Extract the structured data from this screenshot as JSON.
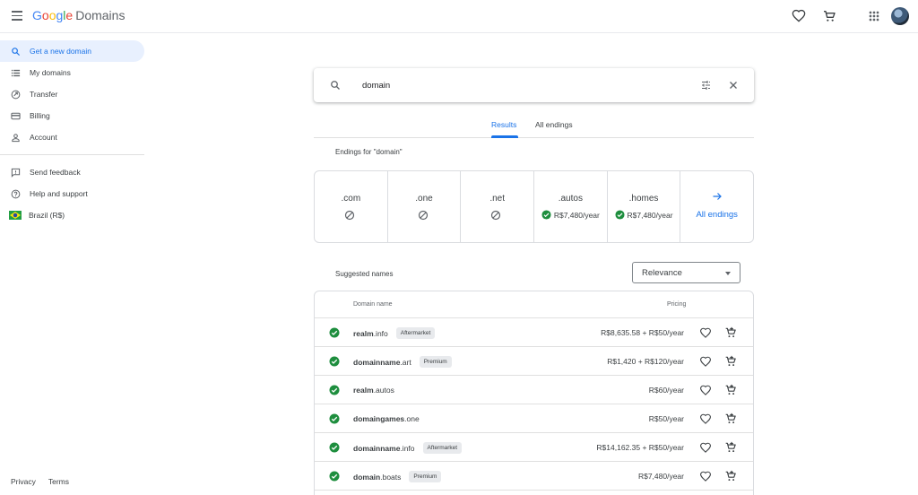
{
  "app": {
    "logo_letters": [
      "G",
      "o",
      "o",
      "g",
      "l",
      "e"
    ],
    "logo_product": "Domains"
  },
  "sidebar": {
    "items": [
      {
        "label": "Get a new domain",
        "icon": "search-icon"
      },
      {
        "label": "My domains",
        "icon": "list-icon"
      },
      {
        "label": "Transfer",
        "icon": "transfer-icon"
      },
      {
        "label": "Billing",
        "icon": "credit-card-icon"
      },
      {
        "label": "Account",
        "icon": "person-icon"
      },
      {
        "label": "Send feedback",
        "icon": "feedback-icon"
      },
      {
        "label": "Help and support",
        "icon": "help-icon"
      },
      {
        "label": "Brazil (R$)",
        "icon": "brazil-flag-icon"
      }
    ],
    "footer": {
      "privacy": "Privacy",
      "terms": "Terms"
    }
  },
  "search": {
    "value": "domain"
  },
  "tabs": [
    {
      "label": "Results",
      "active": true
    },
    {
      "label": "All endings",
      "active": false
    }
  ],
  "endings": {
    "title": "Endings for \"domain\"",
    "items": [
      {
        "tld": ".com",
        "available": false,
        "price": ""
      },
      {
        "tld": ".one",
        "available": false,
        "price": ""
      },
      {
        "tld": ".net",
        "available": false,
        "price": ""
      },
      {
        "tld": ".autos",
        "available": true,
        "price": "R$7,480/year"
      },
      {
        "tld": ".homes",
        "available": true,
        "price": "R$7,480/year"
      }
    ],
    "all_label": "All endings"
  },
  "suggested": {
    "title": "Suggested names",
    "sort": "Relevance",
    "columns": {
      "name": "Domain name",
      "pricing": "Pricing"
    },
    "rows": [
      {
        "sld": "realm",
        "tld": ".info",
        "badge": "Aftermarket",
        "price": "R$8,635.58 + R$50/year"
      },
      {
        "sld": "domainname",
        "tld": ".art",
        "badge": "Premium",
        "price": "R$1,420 + R$120/year"
      },
      {
        "sld": "realm",
        "tld": ".autos",
        "badge": "",
        "price": "R$60/year"
      },
      {
        "sld": "domaingames",
        "tld": ".one",
        "badge": "",
        "price": "R$50/year"
      },
      {
        "sld": "domainname",
        "tld": ".info",
        "badge": "Aftermarket",
        "price": "R$14,162.35 + R$50/year"
      },
      {
        "sld": "domain",
        "tld": ".boats",
        "badge": "Premium",
        "price": "R$7,480/year"
      }
    ]
  },
  "colors": {
    "accent": "#1a73e8",
    "available": "#1e8e3e",
    "active_bg": "#e8f0fe"
  }
}
